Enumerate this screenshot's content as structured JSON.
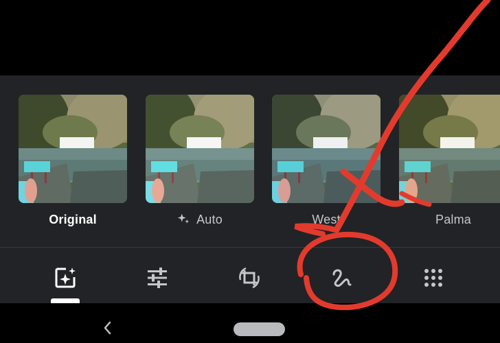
{
  "filters": {
    "items": [
      {
        "label": "Original",
        "selected": true
      },
      {
        "label": "Auto",
        "icon": "sparkle-icon"
      },
      {
        "label": "West"
      },
      {
        "label": "Palma"
      }
    ]
  },
  "toolbar": {
    "tools": [
      {
        "name": "suggestions-tool",
        "icon": "auto-enhance-icon",
        "active": true
      },
      {
        "name": "adjust-tool",
        "icon": "sliders-icon"
      },
      {
        "name": "crop-rotate-tool",
        "icon": "crop-rotate-icon"
      },
      {
        "name": "markup-tool",
        "icon": "squiggle-draw-icon"
      },
      {
        "name": "more-tools",
        "icon": "grid-dots-icon"
      }
    ]
  },
  "navbar": {
    "back_icon": "chevron-left-icon",
    "home_icon": "home-pill-icon"
  },
  "colors": {
    "panel_bg": "#222326",
    "annotation_red": "#e23b2e",
    "active_label": "#ffffff",
    "inactive_label": "#c5c7ca"
  }
}
